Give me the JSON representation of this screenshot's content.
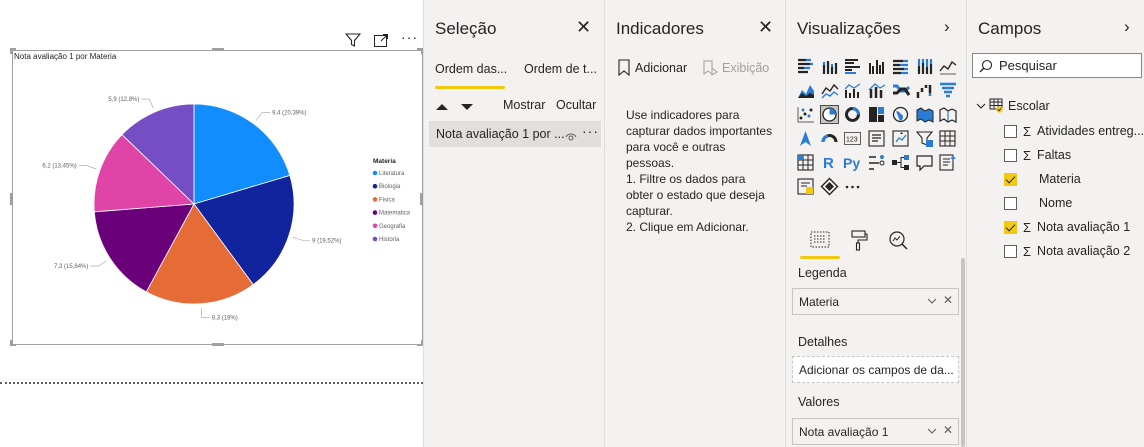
{
  "visual": {
    "title": "Nota avaliação 1 por Materia",
    "header_icons": [
      "filter-icon",
      "focus-mode-icon",
      "more-options-icon"
    ]
  },
  "chart_data": {
    "type": "pie",
    "title": "Nota avaliação 1 por Materia",
    "legend_title": "Materia",
    "legend_position": "right",
    "slices": [
      {
        "name": "Literatura",
        "value": 9.4,
        "label": "9,4 (20,39%)",
        "color": "#118dff"
      },
      {
        "name": "Biologia",
        "value": 9,
        "label": "9 (19,52%)",
        "color": "#12239e"
      },
      {
        "name": "Física",
        "value": 8.3,
        "label": "8,3 (18%)",
        "color": "#e66c37"
      },
      {
        "name": "Matemática",
        "value": 7.3,
        "label": "7,3 (15,84%)",
        "color": "#6b007b"
      },
      {
        "name": "Geografia",
        "value": 6.2,
        "label": "6,2 (13,45%)",
        "color": "#e044a7"
      },
      {
        "name": "Historia",
        "value": 5.9,
        "label": "5,9 (12,8%)",
        "color": "#744ec2"
      }
    ],
    "legend": [
      "Literatura",
      "Biologia",
      "Fisica",
      "Matematica",
      "Geografia",
      "Historia"
    ]
  },
  "selection": {
    "title": "Seleção",
    "tab_layer_order": "Ordem das...",
    "tab_tab_order": "Ordem de t...",
    "show_label": "Mostrar",
    "hide_label": "Ocultar",
    "item_label": "Nota avaliação 1 por ..."
  },
  "bookmarks": {
    "title": "Indicadores",
    "add_label": "Adicionar",
    "view_label": "Exibição",
    "help_text": "Use indicadores para capturar dados importantes para você e outras pessoas.\n1. Filtre os dados para obter o estado que deseja capturar.\n2. Clique em Adicionar."
  },
  "visualizations": {
    "title": "Visualizações",
    "wells": {
      "legend_label": "Legenda",
      "legend_value": "Materia",
      "details_label": "Detalhes",
      "details_placeholder": "Adicionar os campos de da...",
      "values_label": "Valores",
      "values_value": "Nota avaliação 1"
    }
  },
  "fields": {
    "title": "Campos",
    "search_placeholder": "Pesquisar",
    "table_name": "Escolar",
    "items": [
      {
        "label": "Atividades entreg...",
        "sigma": true,
        "checked": false
      },
      {
        "label": "Faltas",
        "sigma": true,
        "checked": false
      },
      {
        "label": "Materia",
        "sigma": false,
        "checked": true
      },
      {
        "label": "Nome",
        "sigma": false,
        "checked": false
      },
      {
        "label": "Nota avaliação 1",
        "sigma": true,
        "checked": true
      },
      {
        "label": "Nota avaliação 2",
        "sigma": true,
        "checked": false
      }
    ]
  },
  "colors": {
    "accent_yellow": "#f2c811",
    "pane_bg": "#f3f2f1",
    "icon_blue": "#2b7cd3",
    "icon_dark": "#252423"
  }
}
